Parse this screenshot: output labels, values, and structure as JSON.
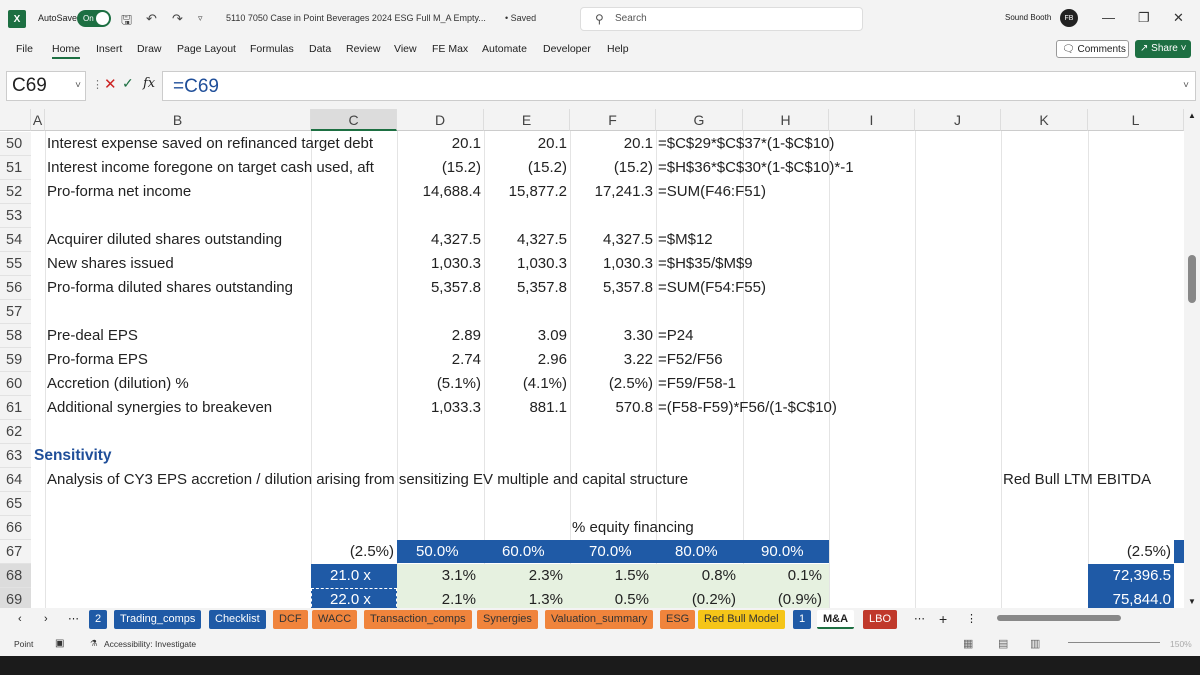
{
  "window": {
    "autosave_label": "AutoSave",
    "autosave_state": "On",
    "title": "5110 7050 Case in Point Beverages 2024 ESG Full M_A Empty...",
    "saved_status": "• Saved",
    "search_placeholder": "Search",
    "user_name": "Sound Booth",
    "user_initials": "FB"
  },
  "ribbon": {
    "menus": [
      "File",
      "Home",
      "Insert",
      "Draw",
      "Page Layout",
      "Formulas",
      "Data",
      "Review",
      "View",
      "FE Max",
      "Automate",
      "Developer",
      "Help"
    ],
    "active_menu": "Home",
    "comments_label": "Comments",
    "share_label": "Share"
  },
  "formula_bar": {
    "name_box": "C69",
    "formula": "=C69",
    "fx_label": "fx"
  },
  "columns": [
    "A",
    "B",
    "C",
    "D",
    "E",
    "F",
    "G",
    "H",
    "I",
    "J",
    "K",
    "L"
  ],
  "selected_column": "C",
  "rows": [
    {
      "num": "50",
      "label": "Interest expense saved on refinanced target debt",
      "d": "20.1",
      "e": "20.1",
      "f": "20.1",
      "g": "=$C$29*$C$37*(1-$C$10)"
    },
    {
      "num": "51",
      "label": "Interest income foregone on target cash used, aft",
      "d": "(15.2)",
      "e": "(15.2)",
      "f": "(15.2)",
      "g": "=$H$36*$C$30*(1-$C$10)*-1"
    },
    {
      "num": "52",
      "label": "Pro-forma net income",
      "d": "14,688.4",
      "e": "15,877.2",
      "f": "17,241.3",
      "g": "=SUM(F46:F51)"
    },
    {
      "num": "53",
      "label": "",
      "d": "",
      "e": "",
      "f": "",
      "g": ""
    },
    {
      "num": "54",
      "label": "Acquirer diluted shares outstanding",
      "d": "4,327.5",
      "e": "4,327.5",
      "f": "4,327.5",
      "g": "=$M$12"
    },
    {
      "num": "55",
      "label": "New shares issued",
      "d": "1,030.3",
      "e": "1,030.3",
      "f": "1,030.3",
      "g": "=$H$35/$M$9"
    },
    {
      "num": "56",
      "label": "Pro-forma diluted shares outstanding",
      "d": "5,357.8",
      "e": "5,357.8",
      "f": "5,357.8",
      "g": "=SUM(F54:F55)"
    },
    {
      "num": "57",
      "label": "",
      "d": "",
      "e": "",
      "f": "",
      "g": ""
    },
    {
      "num": "58",
      "label": "Pre-deal EPS",
      "d": "2.89",
      "e": "3.09",
      "f": "3.30",
      "g": "=P24"
    },
    {
      "num": "59",
      "label": "Pro-forma EPS",
      "d": "2.74",
      "e": "2.96",
      "f": "3.22",
      "g": "=F52/F56"
    },
    {
      "num": "60",
      "label": "Accretion (dilution) %",
      "d": "(5.1%)",
      "e": "(4.1%)",
      "f": "(2.5%)",
      "g": "=F59/F58-1"
    },
    {
      "num": "61",
      "label": "Additional synergies to breakeven",
      "d": "1,033.3",
      "e": "881.1",
      "f": "570.8",
      "g": "=(F58-F59)*F56/(1-$C$10)"
    },
    {
      "num": "62",
      "label": "",
      "d": "",
      "e": "",
      "f": "",
      "g": ""
    }
  ],
  "sensitivity": {
    "row63_num": "63",
    "row64_num": "64",
    "row65_num": "65",
    "row66_num": "66",
    "row67_num": "67",
    "row68_num": "68",
    "row69_num": "69",
    "heading": "Sensitivity",
    "description": "Analysis of CY3 EPS accretion / dilution arising from sensitizing EV multiple and capital structure",
    "right_title": "Red Bull LTM EBITDA",
    "equity_label": "% equity financing",
    "corner_value": "(2.5%)",
    "equity_headers": [
      "50.0%",
      "60.0%",
      "70.0%",
      "80.0%",
      "90.0%"
    ],
    "multiples": [
      "21.0 x",
      "22.0 x"
    ],
    "grid_values": [
      [
        "3.1%",
        "2.3%",
        "1.5%",
        "0.8%",
        "0.1%"
      ],
      [
        "2.1%",
        "1.3%",
        "0.5%",
        "(0.2%)",
        "(0.9%)"
      ]
    ],
    "right_corner_value": "(2.5%)",
    "right_values": [
      "72,396.5",
      "75,844.0"
    ]
  },
  "sheet_tabs": {
    "num_badge_1": "2",
    "num_badge_2": "1",
    "tabs": [
      {
        "label": "Trading_comps",
        "style": "blue"
      },
      {
        "label": "Checklist",
        "style": "blue"
      },
      {
        "label": "DCF",
        "style": "orange"
      },
      {
        "label": "WACC",
        "style": "orange"
      },
      {
        "label": "Transaction_comps",
        "style": "orange"
      },
      {
        "label": "Synergies",
        "style": "orange"
      },
      {
        "label": "Valuation_summary",
        "style": "orange"
      },
      {
        "label": "ESG",
        "style": "orange"
      },
      {
        "label": "Red Bull Model",
        "style": "yellow"
      },
      {
        "label": "M&A",
        "style": "active"
      },
      {
        "label": "LBO",
        "style": "red"
      }
    ]
  },
  "status_bar": {
    "mode": "Point",
    "accessibility": "Accessibility: Investigate",
    "zoom": "150%"
  }
}
